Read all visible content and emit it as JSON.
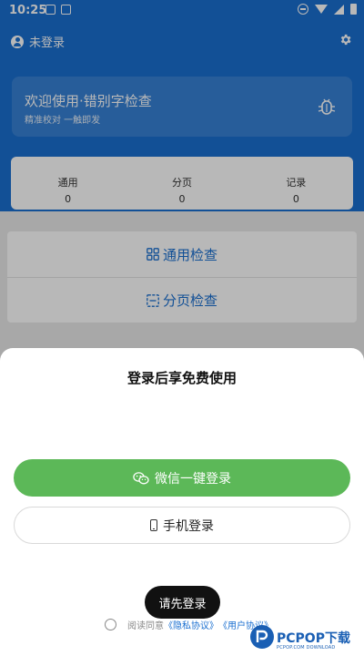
{
  "status_bar": {
    "time": "10:25"
  },
  "header": {
    "login_status": "未登录",
    "welcome_title": "欢迎使用·错别字检查",
    "welcome_subtitle": "精准校对 一触即发"
  },
  "stats": [
    {
      "label": "通用",
      "value": "0"
    },
    {
      "label": "分页",
      "value": "0"
    },
    {
      "label": "记录",
      "value": "0"
    }
  ],
  "actions": {
    "general_check": "通用检查",
    "paging_check": "分页检查"
  },
  "sheet": {
    "title": "登录后享免费使用",
    "wechat_login": "微信一键登录",
    "phone_login": "手机登录",
    "toast": "请先登录",
    "agree_prefix": "阅读同意",
    "privacy_link": "《隐私协议》",
    "user_link": "《用户协议》"
  },
  "watermark": {
    "brand": "PCPOP下载",
    "sub": "PCPOP.COM DOWNLOAD"
  },
  "colors": {
    "primary": "#1a6fd0",
    "wechat_green": "#5cb858"
  }
}
